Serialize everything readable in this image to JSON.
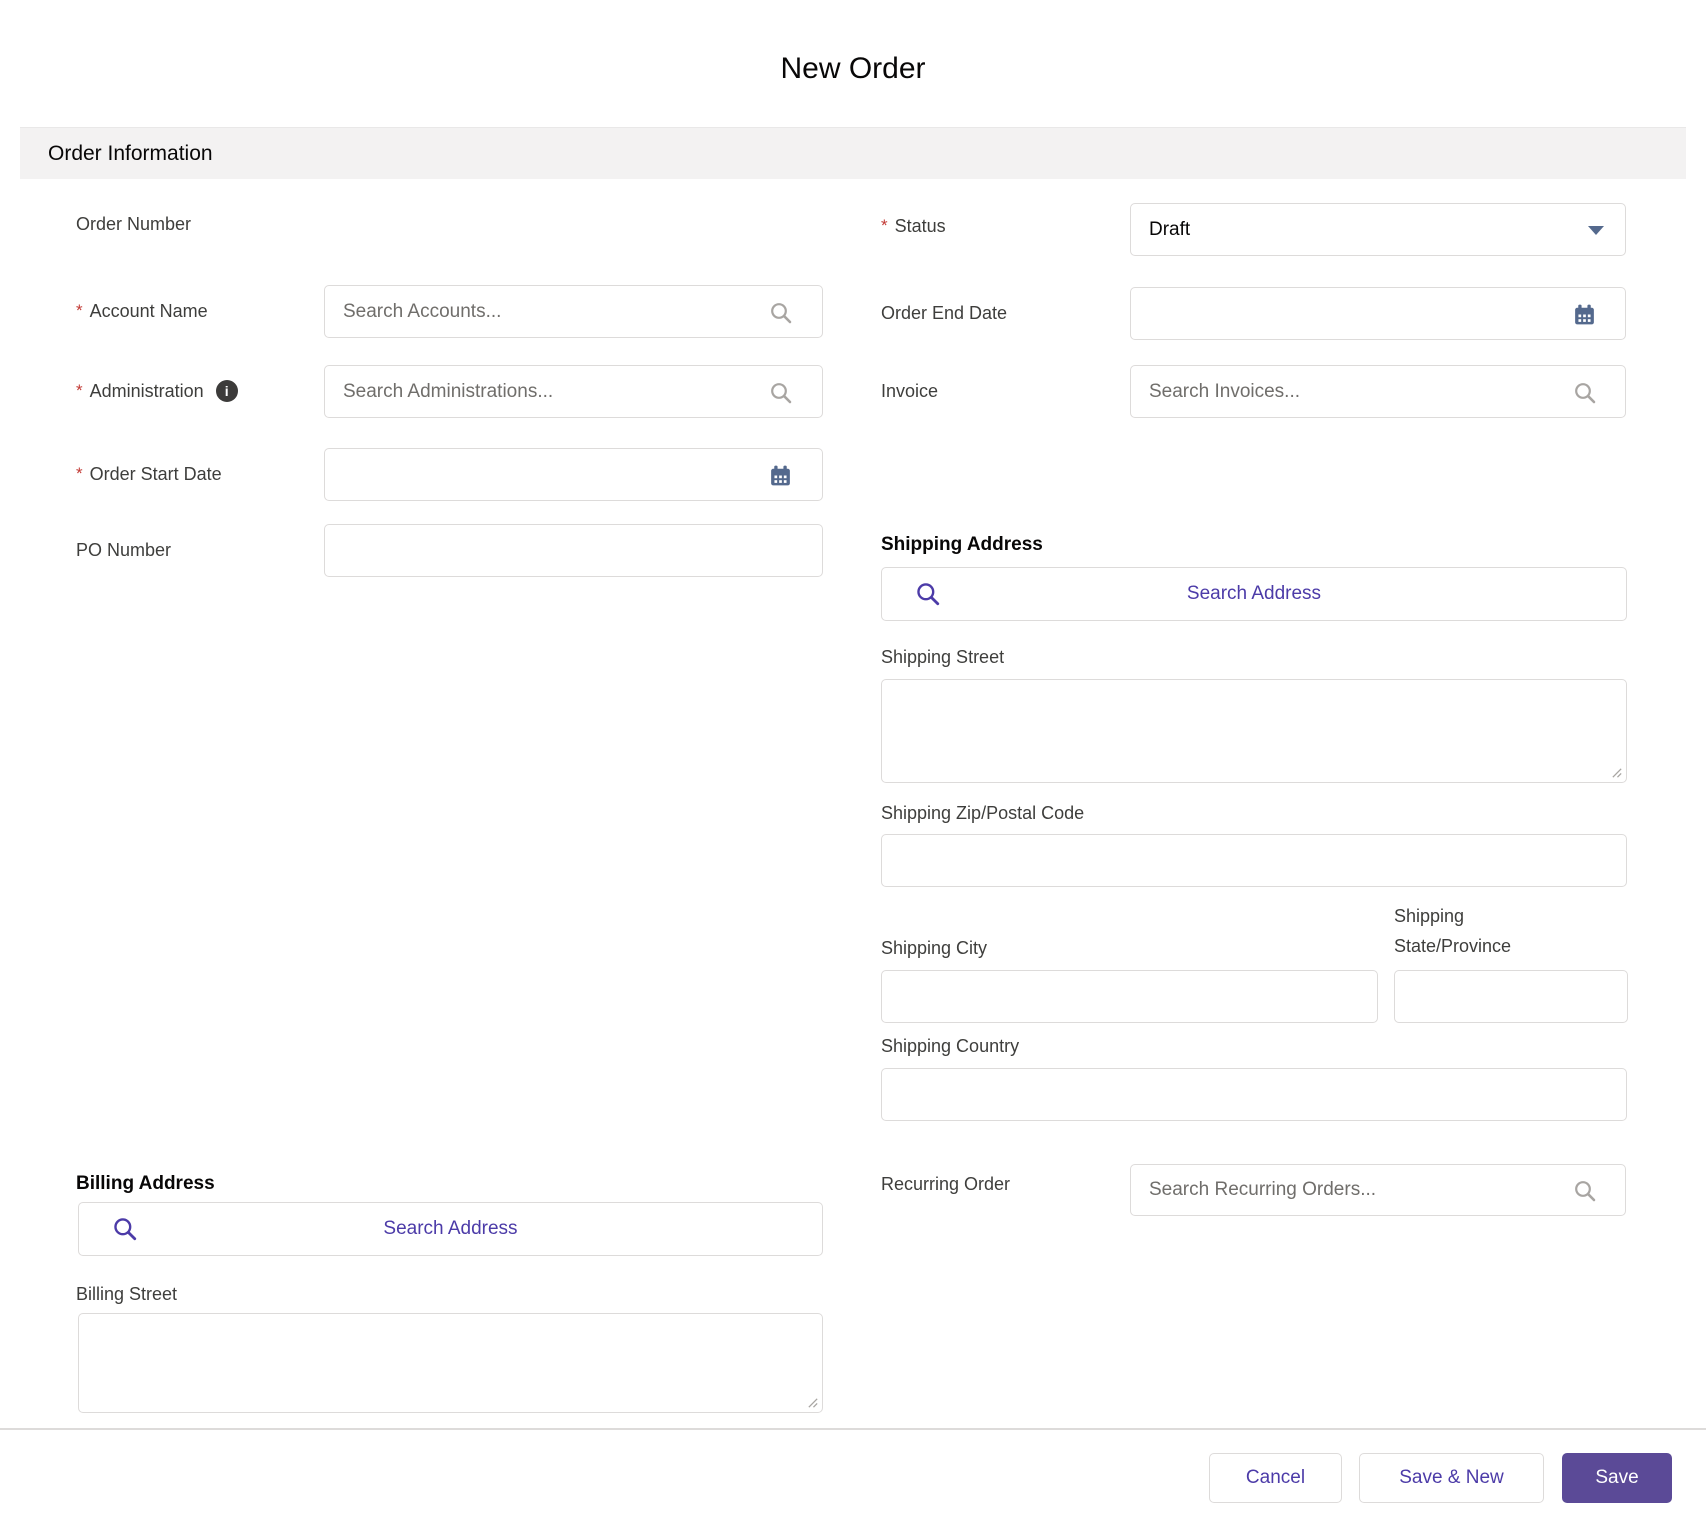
{
  "title": "New Order",
  "section_header": "Order Information",
  "required_marker": "*",
  "icons": {
    "info_glyph": "i"
  },
  "left": {
    "order_number_label": "Order Number",
    "account_name": {
      "label": "Account Name",
      "required": true,
      "placeholder": "Search Accounts..."
    },
    "administration": {
      "label": "Administration",
      "required": true,
      "placeholder": "Search Administrations..."
    },
    "order_start_date": {
      "label": "Order Start Date",
      "required": true,
      "value": ""
    },
    "po_number": {
      "label": "PO Number",
      "value": ""
    }
  },
  "right": {
    "status": {
      "label": "Status",
      "required": true,
      "value": "Draft"
    },
    "order_end_date": {
      "label": "Order End Date",
      "value": ""
    },
    "invoice": {
      "label": "Invoice",
      "placeholder": "Search Invoices..."
    },
    "recurring_order": {
      "label": "Recurring Order",
      "placeholder": "Search Recurring Orders..."
    }
  },
  "shipping": {
    "heading": "Shipping Address",
    "search_address_label": "Search Address",
    "street_label": "Shipping Street",
    "zip_label": "Shipping Zip/Postal Code",
    "city_label": "Shipping City",
    "state_label": "Shipping State/Province",
    "country_label": "Shipping Country"
  },
  "billing": {
    "heading": "Billing Address",
    "search_address_label": "Search Address",
    "street_label": "Billing Street"
  },
  "footer": {
    "cancel_label": "Cancel",
    "save_new_label": "Save & New",
    "save_label": "Save"
  },
  "colors": {
    "brand_purple": "#5b4a97",
    "action_text_purple": "#4c3ba8",
    "required_red": "#c23934",
    "border_gray": "#dddbda",
    "label_gray": "#3e3e3c",
    "placeholder_gray": "#706e6b",
    "icon_slate": "#54698d",
    "section_header_bg": "#f3f2f2"
  }
}
